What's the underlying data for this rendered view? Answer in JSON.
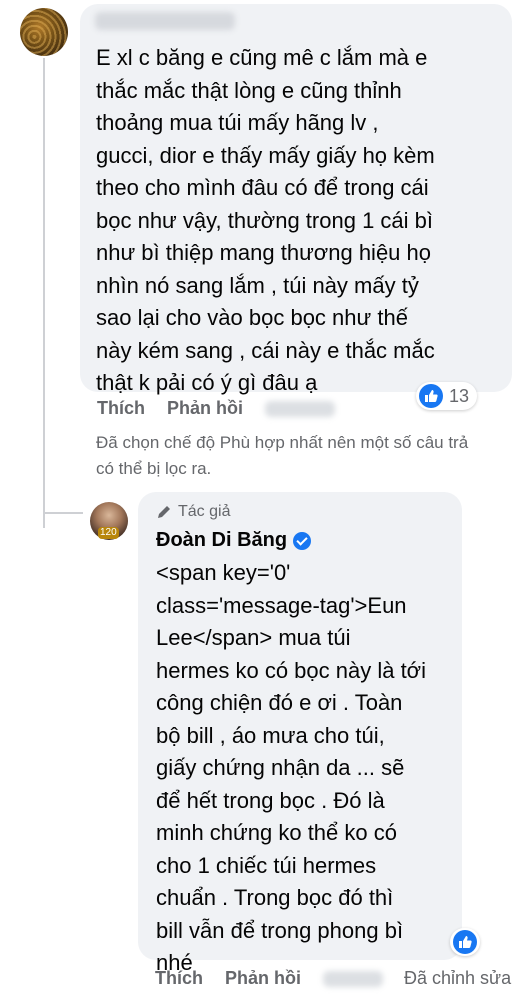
{
  "comment1": {
    "text": "E xl c băng e cũng mê c lắm mà e\nthắc mắc thật lòng e cũng thỉnh\nthoảng mua túi mấy hãng lv ,\ngucci, dior e thấy mấy giấy họ kèm\ntheo cho mình đâu có để trong cái\nbọc như vậy, thường trong 1 cái bì\nnhư bì thiệp mang thương hiệu họ\nnhìn nó sang lắm , túi này mấy tỷ\nsao lại cho vào bọc bọc như thế\nnày kém sang , cái này e thắc mắc\nthật k pải có ý gì đâu ạ",
    "reaction_count": "13",
    "like_label": "Thích",
    "reply_label": "Phản hồi"
  },
  "filter_note": "Đã chọn chế độ Phù hợp nhất nên một số câu trả\ncó thể bị lọc ra.",
  "reply": {
    "author_tag": "Tác giả",
    "author_name": "Đoàn Di Băng",
    "avatar_badge": "120",
    "text": "<span key='0'\nclass='message-tag'>Eun\nLee</span> mua túi\nhermes ko có bọc này là tới\ncông chiện đó e ơi . Toàn\nbộ bill , áo mưa cho túi,\ngiấy chứng nhận da ... sẽ\nđể hết trong bọc . Đó là\nminh chứng ko thể ko có\ncho 1 chiếc túi hermes\nchuẩn . Trong bọc đó thì\nbill vẫn để trong phong bì\nnhé",
    "like_label": "Thích",
    "reply_label": "Phản hồi",
    "edited_label": "Đã chỉnh sửa"
  },
  "colors": {
    "accent": "#1877f2",
    "bubble": "#f0f2f5",
    "muted": "#65676b"
  }
}
